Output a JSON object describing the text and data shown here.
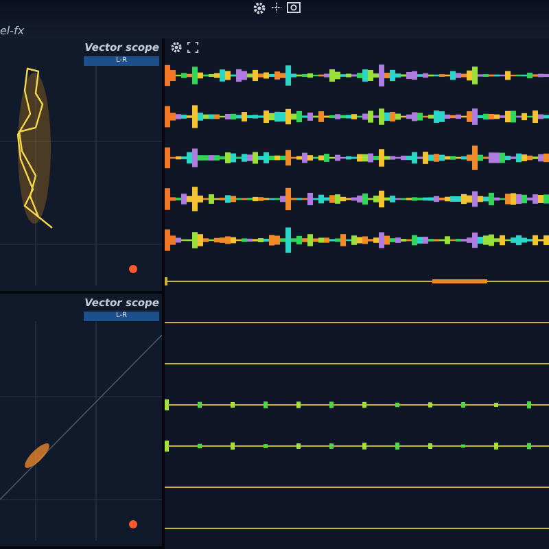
{
  "window": {
    "title": "el-fx"
  },
  "scopes": [
    {
      "title": "Vector scope",
      "mode": "L-R",
      "kind": "wide"
    },
    {
      "title": "Vector scope",
      "mode": "L-R",
      "kind": "mono"
    }
  ],
  "tracks": [
    {
      "kind": "busy"
    },
    {
      "kind": "busy"
    },
    {
      "kind": "busy"
    },
    {
      "kind": "busy"
    },
    {
      "kind": "busy"
    },
    {
      "kind": "quiet"
    },
    {
      "kind": "flat"
    },
    {
      "kind": "flat"
    },
    {
      "kind": "blips"
    },
    {
      "kind": "blips"
    },
    {
      "kind": "flat"
    },
    {
      "kind": "flat"
    }
  ]
}
